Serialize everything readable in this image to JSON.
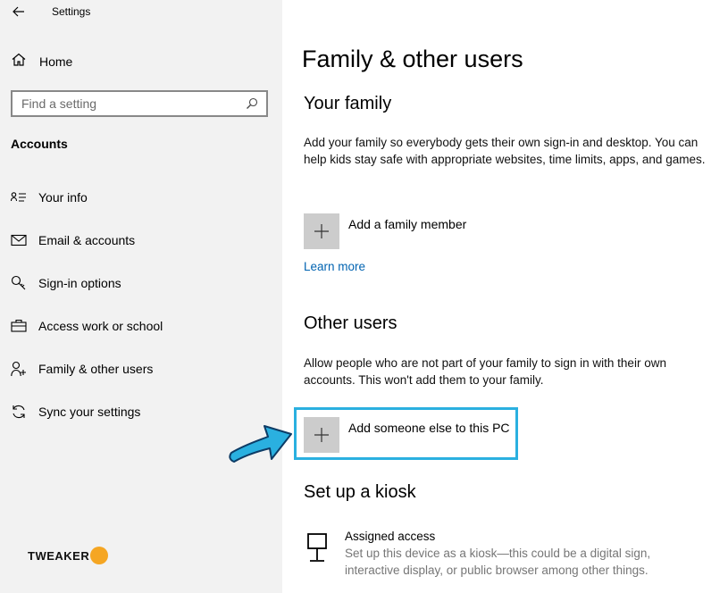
{
  "window": {
    "title": "Settings"
  },
  "sidebar": {
    "home_label": "Home",
    "search_placeholder": "Find a setting",
    "section_label": "Accounts",
    "items": [
      {
        "label": "Your info",
        "icon": "person-card-icon"
      },
      {
        "label": "Email & accounts",
        "icon": "envelope-icon"
      },
      {
        "label": "Sign-in options",
        "icon": "key-icon"
      },
      {
        "label": "Access work or school",
        "icon": "briefcase-icon"
      },
      {
        "label": "Family & other users",
        "icon": "person-add-icon"
      },
      {
        "label": "Sync your settings",
        "icon": "sync-icon"
      }
    ],
    "brand": "TWEAKER"
  },
  "main": {
    "title": "Family & other users",
    "your_family": {
      "heading": "Your family",
      "description": "Add your family so everybody gets their own sign-in and desktop. You can help kids stay safe with appropriate websites, time limits, apps, and games.",
      "add_label": "Add a family member",
      "learn_more": "Learn more"
    },
    "other_users": {
      "heading": "Other users",
      "description": "Allow people who are not part of your family to sign in with their own accounts. This won't add them to your family.",
      "add_label": "Add someone else to this PC"
    },
    "kiosk": {
      "heading": "Set up a kiosk",
      "title": "Assigned access",
      "description": "Set up this device as a kiosk—this could be a digital sign, interactive display, or public browser among other things."
    }
  },
  "colors": {
    "accent_link": "#0063b1",
    "highlight_border": "#2ab0e0",
    "arrow_fill": "#2ab0e0",
    "sidebar_bg": "#f2f2f2",
    "plus_box_bg": "#cccccc"
  }
}
